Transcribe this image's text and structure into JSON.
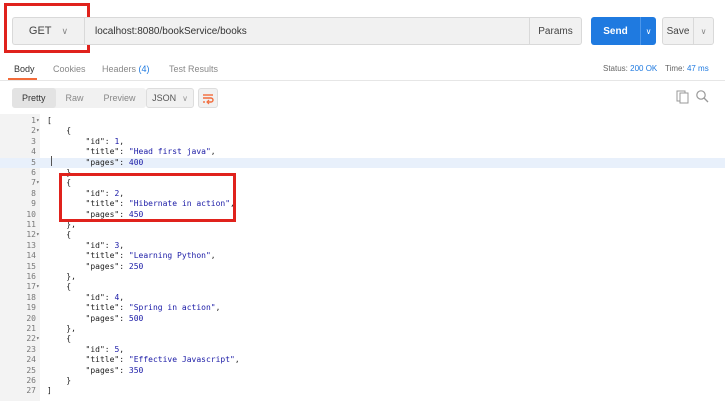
{
  "request": {
    "method": "GET",
    "url": "localhost:8080/bookService/books",
    "params_label": "Params",
    "send_label": "Send",
    "save_label": "Save"
  },
  "response_tabs": [
    "Body",
    "Cookies",
    "Headers",
    "Test Results"
  ],
  "headers_count": "(4)",
  "status": {
    "label": "Status:",
    "value": "200 OK",
    "time_label": "Time:",
    "time_value": "47 ms"
  },
  "formats": [
    "Pretty",
    "Raw",
    "Preview"
  ],
  "language": "JSON",
  "icons": [
    "chevron-down-icon",
    "wrap-lines-icon",
    "copy-icon",
    "search-icon"
  ],
  "colors": {
    "accent": "#1f7ae0",
    "highlight": "#e0221c",
    "tab_underline": "#f26b3a"
  },
  "code_lines": [
    {
      "n": "1",
      "fold": true,
      "t": "["
    },
    {
      "n": "2",
      "fold": true,
      "t": "    {"
    },
    {
      "n": "3",
      "fold": false,
      "t": "        \"id\": 1,"
    },
    {
      "n": "4",
      "fold": false,
      "t": "        \"title\": \"Head first java\","
    },
    {
      "n": "5",
      "fold": false,
      "t": "        \"pages\": 400"
    },
    {
      "n": "6",
      "fold": false,
      "t": "    },"
    },
    {
      "n": "7",
      "fold": true,
      "t": "    {"
    },
    {
      "n": "8",
      "fold": false,
      "t": "        \"id\": 2,"
    },
    {
      "n": "9",
      "fold": false,
      "t": "        \"title\": \"Hibernate in action\","
    },
    {
      "n": "10",
      "fold": false,
      "t": "        \"pages\": 450"
    },
    {
      "n": "11",
      "fold": false,
      "t": "    },"
    },
    {
      "n": "12",
      "fold": true,
      "t": "    {"
    },
    {
      "n": "13",
      "fold": false,
      "t": "        \"id\": 3,"
    },
    {
      "n": "14",
      "fold": false,
      "t": "        \"title\": \"Learning Python\","
    },
    {
      "n": "15",
      "fold": false,
      "t": "        \"pages\": 250"
    },
    {
      "n": "16",
      "fold": false,
      "t": "    },"
    },
    {
      "n": "17",
      "fold": true,
      "t": "    {"
    },
    {
      "n": "18",
      "fold": false,
      "t": "        \"id\": 4,"
    },
    {
      "n": "19",
      "fold": false,
      "t": "        \"title\": \"Spring in action\","
    },
    {
      "n": "20",
      "fold": false,
      "t": "        \"pages\": 500"
    },
    {
      "n": "21",
      "fold": false,
      "t": "    },"
    },
    {
      "n": "22",
      "fold": true,
      "t": "    {"
    },
    {
      "n": "23",
      "fold": false,
      "t": "        \"id\": 5,"
    },
    {
      "n": "24",
      "fold": false,
      "t": "        \"title\": \"Effective Javascript\","
    },
    {
      "n": "25",
      "fold": false,
      "t": "        \"pages\": 350"
    },
    {
      "n": "26",
      "fold": false,
      "t": "    }"
    },
    {
      "n": "27",
      "fold": false,
      "t": "]"
    }
  ],
  "highlighted_line": "5"
}
